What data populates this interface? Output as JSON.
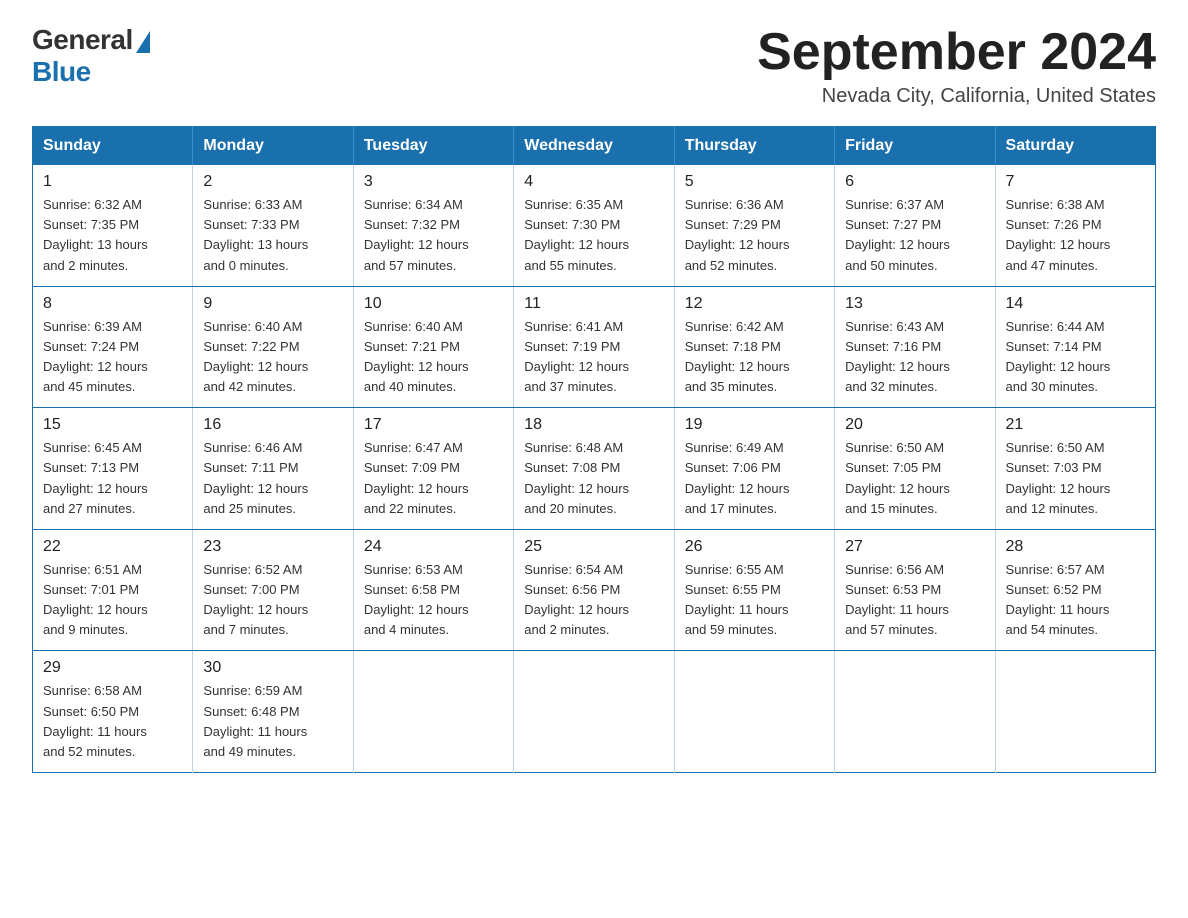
{
  "logo": {
    "general": "General",
    "blue": "Blue"
  },
  "title": {
    "month_year": "September 2024",
    "location": "Nevada City, California, United States"
  },
  "headers": [
    "Sunday",
    "Monday",
    "Tuesday",
    "Wednesday",
    "Thursday",
    "Friday",
    "Saturday"
  ],
  "weeks": [
    [
      {
        "day": "1",
        "sunrise": "6:32 AM",
        "sunset": "7:35 PM",
        "daylight": "13 hours and 2 minutes."
      },
      {
        "day": "2",
        "sunrise": "6:33 AM",
        "sunset": "7:33 PM",
        "daylight": "13 hours and 0 minutes."
      },
      {
        "day": "3",
        "sunrise": "6:34 AM",
        "sunset": "7:32 PM",
        "daylight": "12 hours and 57 minutes."
      },
      {
        "day": "4",
        "sunrise": "6:35 AM",
        "sunset": "7:30 PM",
        "daylight": "12 hours and 55 minutes."
      },
      {
        "day": "5",
        "sunrise": "6:36 AM",
        "sunset": "7:29 PM",
        "daylight": "12 hours and 52 minutes."
      },
      {
        "day": "6",
        "sunrise": "6:37 AM",
        "sunset": "7:27 PM",
        "daylight": "12 hours and 50 minutes."
      },
      {
        "day": "7",
        "sunrise": "6:38 AM",
        "sunset": "7:26 PM",
        "daylight": "12 hours and 47 minutes."
      }
    ],
    [
      {
        "day": "8",
        "sunrise": "6:39 AM",
        "sunset": "7:24 PM",
        "daylight": "12 hours and 45 minutes."
      },
      {
        "day": "9",
        "sunrise": "6:40 AM",
        "sunset": "7:22 PM",
        "daylight": "12 hours and 42 minutes."
      },
      {
        "day": "10",
        "sunrise": "6:40 AM",
        "sunset": "7:21 PM",
        "daylight": "12 hours and 40 minutes."
      },
      {
        "day": "11",
        "sunrise": "6:41 AM",
        "sunset": "7:19 PM",
        "daylight": "12 hours and 37 minutes."
      },
      {
        "day": "12",
        "sunrise": "6:42 AM",
        "sunset": "7:18 PM",
        "daylight": "12 hours and 35 minutes."
      },
      {
        "day": "13",
        "sunrise": "6:43 AM",
        "sunset": "7:16 PM",
        "daylight": "12 hours and 32 minutes."
      },
      {
        "day": "14",
        "sunrise": "6:44 AM",
        "sunset": "7:14 PM",
        "daylight": "12 hours and 30 minutes."
      }
    ],
    [
      {
        "day": "15",
        "sunrise": "6:45 AM",
        "sunset": "7:13 PM",
        "daylight": "12 hours and 27 minutes."
      },
      {
        "day": "16",
        "sunrise": "6:46 AM",
        "sunset": "7:11 PM",
        "daylight": "12 hours and 25 minutes."
      },
      {
        "day": "17",
        "sunrise": "6:47 AM",
        "sunset": "7:09 PM",
        "daylight": "12 hours and 22 minutes."
      },
      {
        "day": "18",
        "sunrise": "6:48 AM",
        "sunset": "7:08 PM",
        "daylight": "12 hours and 20 minutes."
      },
      {
        "day": "19",
        "sunrise": "6:49 AM",
        "sunset": "7:06 PM",
        "daylight": "12 hours and 17 minutes."
      },
      {
        "day": "20",
        "sunrise": "6:50 AM",
        "sunset": "7:05 PM",
        "daylight": "12 hours and 15 minutes."
      },
      {
        "day": "21",
        "sunrise": "6:50 AM",
        "sunset": "7:03 PM",
        "daylight": "12 hours and 12 minutes."
      }
    ],
    [
      {
        "day": "22",
        "sunrise": "6:51 AM",
        "sunset": "7:01 PM",
        "daylight": "12 hours and 9 minutes."
      },
      {
        "day": "23",
        "sunrise": "6:52 AM",
        "sunset": "7:00 PM",
        "daylight": "12 hours and 7 minutes."
      },
      {
        "day": "24",
        "sunrise": "6:53 AM",
        "sunset": "6:58 PM",
        "daylight": "12 hours and 4 minutes."
      },
      {
        "day": "25",
        "sunrise": "6:54 AM",
        "sunset": "6:56 PM",
        "daylight": "12 hours and 2 minutes."
      },
      {
        "day": "26",
        "sunrise": "6:55 AM",
        "sunset": "6:55 PM",
        "daylight": "11 hours and 59 minutes."
      },
      {
        "day": "27",
        "sunrise": "6:56 AM",
        "sunset": "6:53 PM",
        "daylight": "11 hours and 57 minutes."
      },
      {
        "day": "28",
        "sunrise": "6:57 AM",
        "sunset": "6:52 PM",
        "daylight": "11 hours and 54 minutes."
      }
    ],
    [
      {
        "day": "29",
        "sunrise": "6:58 AM",
        "sunset": "6:50 PM",
        "daylight": "11 hours and 52 minutes."
      },
      {
        "day": "30",
        "sunrise": "6:59 AM",
        "sunset": "6:48 PM",
        "daylight": "11 hours and 49 minutes."
      },
      null,
      null,
      null,
      null,
      null
    ]
  ],
  "labels": {
    "sunrise": "Sunrise:",
    "sunset": "Sunset:",
    "daylight": "Daylight:"
  }
}
